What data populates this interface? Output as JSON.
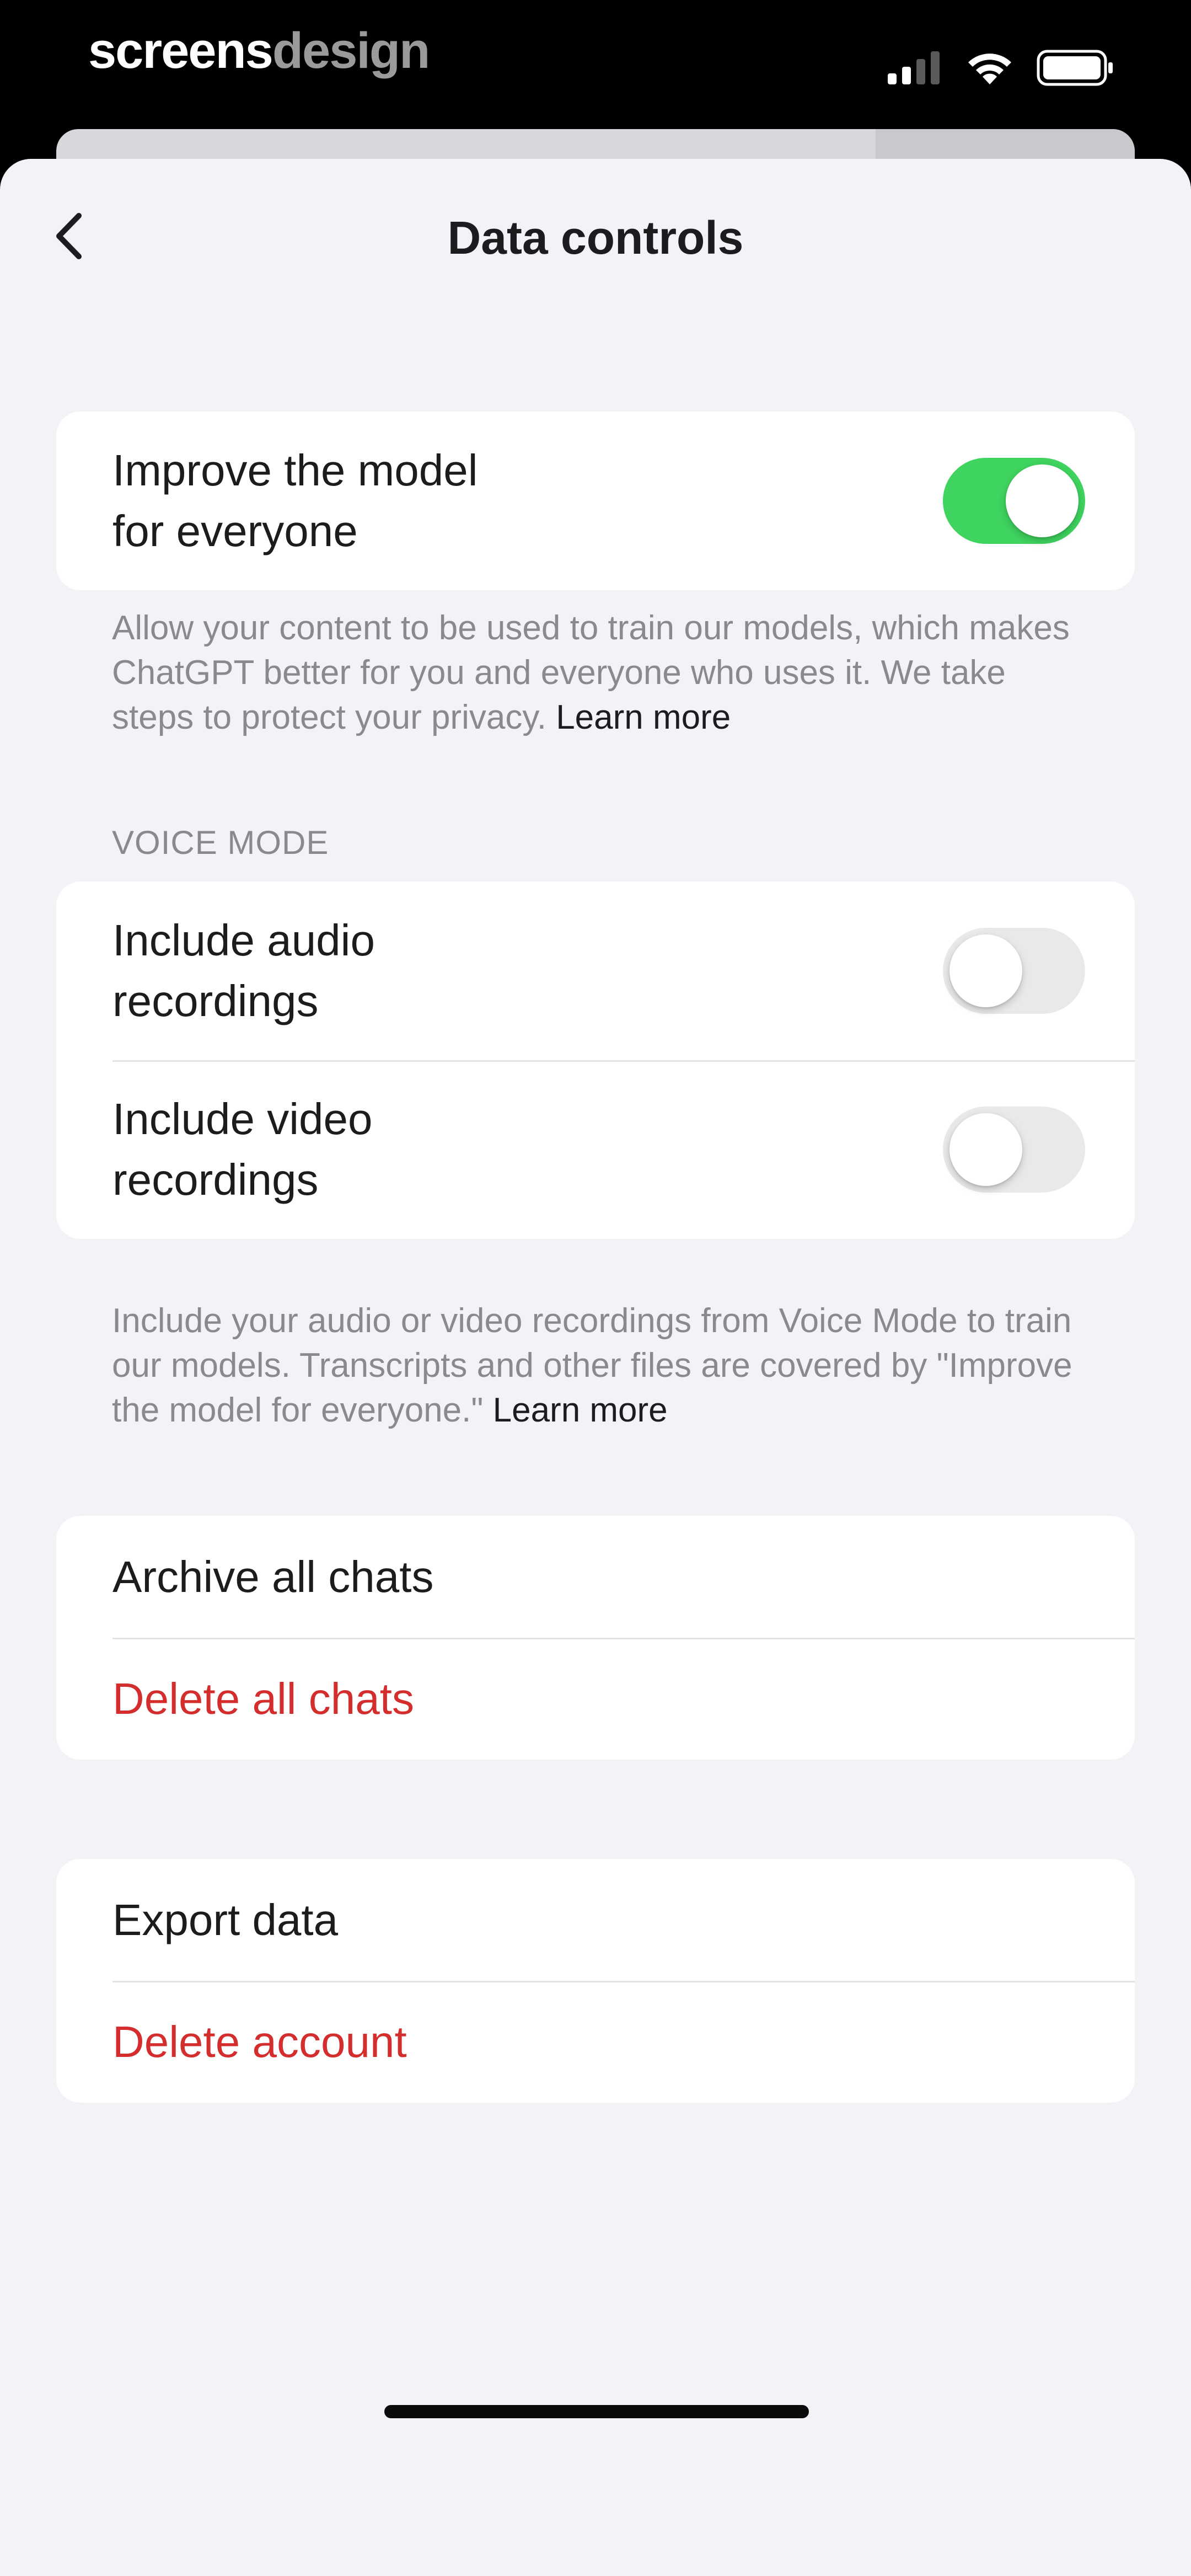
{
  "status_bar": {
    "brand_bold": "screens",
    "brand_light": "design"
  },
  "nav": {
    "title": "Data controls"
  },
  "improve_model": {
    "label": "Improve the model\nfor everyone",
    "enabled": true,
    "footnote_text": "Allow your content to be used to train our models, which makes ChatGPT better for you and everyone who uses it. We take steps to protect your privacy. ",
    "footnote_link": "Learn more"
  },
  "voice_mode": {
    "section_header": "VOICE MODE",
    "audio_label": "Include audio\nrecordings",
    "audio_enabled": false,
    "video_label": "Include video\nrecordings",
    "video_enabled": false,
    "footnote_text": "Include your audio or video recordings from Voice Mode to train our models. Transcripts and other files are covered by \"Improve the model for everyone.\" ",
    "footnote_link": "Learn more"
  },
  "chats": {
    "archive_label": "Archive all chats",
    "delete_label": "Delete all chats"
  },
  "account": {
    "export_label": "Export data",
    "delete_label": "Delete account"
  },
  "colors": {
    "toggle_on": "#3fd35f",
    "danger": "#d32d2d",
    "background": "#f2f2f7"
  }
}
